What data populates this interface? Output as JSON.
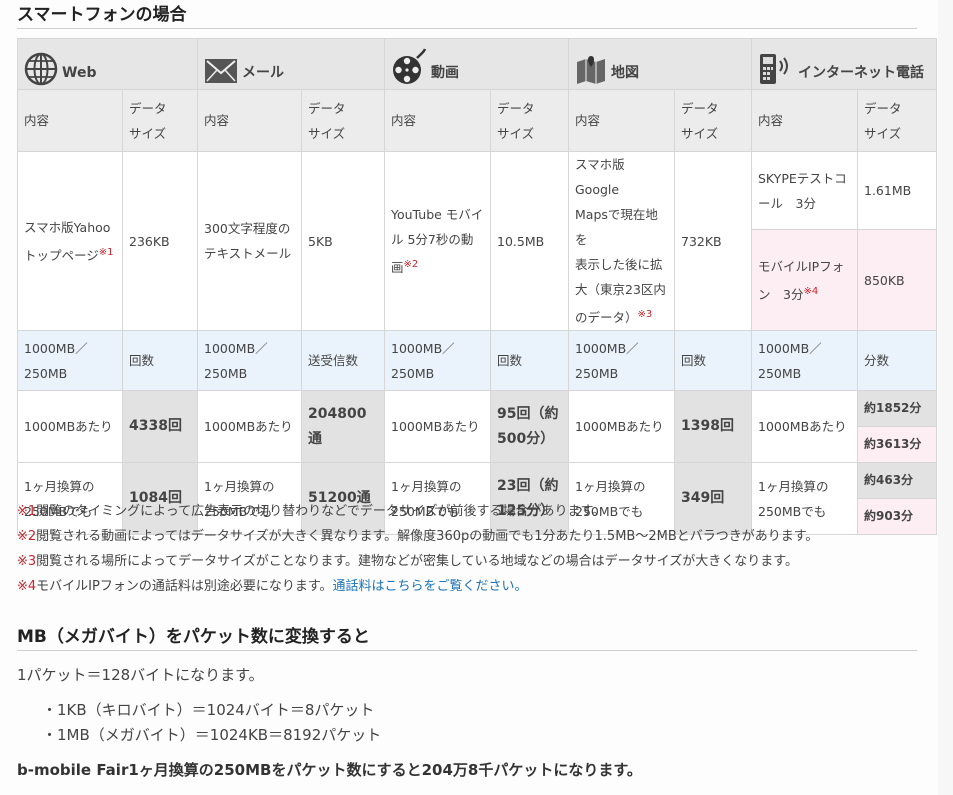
{
  "section_title": "スマートフォンの場合",
  "categories": [
    {
      "label": "Web",
      "icon": "globe-icon"
    },
    {
      "label": "メール",
      "icon": "envelope-icon"
    },
    {
      "label": "動画",
      "icon": "film-reel-icon"
    },
    {
      "label": "地図",
      "icon": "map-icon"
    },
    {
      "label": "インターネット電話",
      "icon": "phone-icon"
    }
  ],
  "subhead": {
    "content": "内容",
    "size_line1": "データ",
    "size_line2": "サイズ"
  },
  "contents": {
    "web_a": "スマホ版Yahoo",
    "web_b": "トップページ",
    "web_mark": "※1",
    "web_size": "236KB",
    "mail_a": "300文字程度の",
    "mail_b": "テキストメール",
    "mail_size": "5KB",
    "video_a": "YouTube モバイ",
    "video_b": "ル 5分7秒の動",
    "video_c": "画",
    "video_mark": "※2",
    "video_size": "10.5MB",
    "map_a": "スマホ版Google",
    "map_b": "Mapsで現在地を",
    "map_c": "表示した後に拡",
    "map_d": "大（東京23区内",
    "map_e": "のデータ）",
    "map_mark": "※3",
    "map_size": "732KB",
    "phone1": "SKYPEテストコ",
    "phone1b": "ール　3分",
    "phone1_size": "1.61MB",
    "phone2": "モバイルIPフォ",
    "phone2b": "ン　3分",
    "phone2_mark": "※4",
    "phone2_size": "850KB"
  },
  "plan": {
    "line1": "1000MB／",
    "line2": "250MB",
    "count": "回数",
    "sent": "送受信数",
    "minutes": "分数"
  },
  "per1000": {
    "label": "1000MBあたり",
    "web": "4338回",
    "mail_a": "204800",
    "mail_b": "通",
    "video_a": "95回（約",
    "video_b": "500分）",
    "map": "1398回",
    "phone1": "約1852分",
    "phone2": "約3613分"
  },
  "monthly": {
    "label_a": "1ヶ月換算の",
    "label_b": "250MBでも",
    "web": "1084回",
    "mail": "51200通",
    "video_a": "23回（約",
    "video_b": "125分）",
    "map": "349回",
    "phone1": "約463分",
    "phone2": "約903分"
  },
  "notes": [
    {
      "mark": "※1",
      "text": "閲覧のタイミングによって広告表示の切り替わりなどでデータサイズが前後する場合があります。"
    },
    {
      "mark": "※2",
      "text": "閲覧される動画によってはデータサイズが大きく異なります。解像度360pの動画でも1分あたり1.5MB～2MBとバラつきがあります。"
    },
    {
      "mark": "※3",
      "text": "閲覧される場所によってデータサイズがことなります。建物などが密集している地域などの場合はデータサイズが大きくなります。"
    },
    {
      "mark": "※4",
      "text": "モバイルIPフォンの通話料は別途必要になります。",
      "link": "通話料はこちらをご覧ください。"
    }
  ],
  "conversion": {
    "title": "MB（メガバイト）をパケット数に変換すると",
    "intro": "1パケット＝128バイトになります。",
    "items": [
      "・1KB（キロバイト）＝1024バイト＝8パケット",
      "・1MB（メガバイト）＝1024KB＝8192パケット"
    ],
    "summary": "b-mobile Fair1ヶ月換算の250MBをパケット数にすると204万8千パケットになります。"
  },
  "colors": {
    "note_mark": "#c8262b",
    "link": "#1a73b8",
    "highlight_pink": "#fdeef3",
    "plan_row": "#eaf3fb"
  }
}
